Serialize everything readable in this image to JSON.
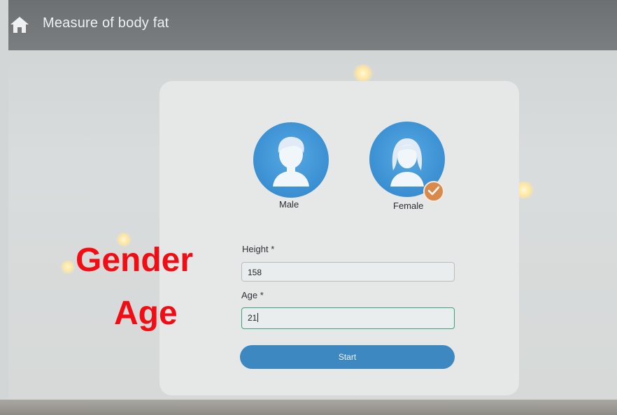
{
  "header": {
    "title": "Measure of body fat",
    "home_icon": "home-icon"
  },
  "gender": {
    "options": [
      {
        "label": "Male",
        "icon": "male-avatar-icon",
        "selected": false
      },
      {
        "label": "Female",
        "icon": "female-avatar-icon",
        "selected": true
      }
    ],
    "selected_icon": "checkmark-icon"
  },
  "form": {
    "height": {
      "label": "Height *",
      "value": "158"
    },
    "age": {
      "label": "Age *",
      "value": "21"
    },
    "start_label": "Start"
  },
  "overlay": {
    "gender_text": "Gender",
    "age_text": "Age"
  },
  "colors": {
    "topbar": "#6d7072",
    "avatar": "#3a8fd2",
    "check": "#d9894a",
    "start_button": "#3e88c2",
    "focused_border": "#3f9f7f",
    "overlay_red": "#f20d14"
  }
}
